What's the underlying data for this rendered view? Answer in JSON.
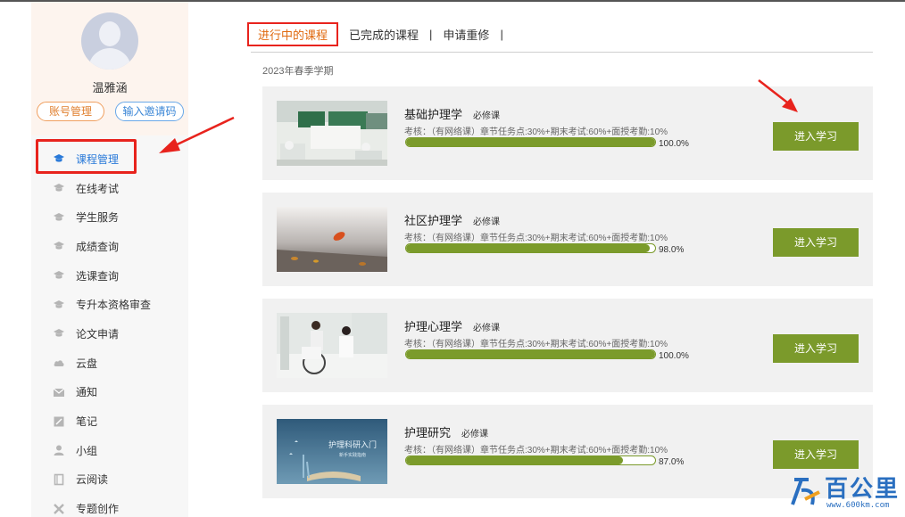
{
  "sidebar": {
    "username": "温雅涵",
    "account_button": "账号管理",
    "invite_button": "输入邀请码",
    "items": [
      {
        "label": "课程管理",
        "icon": "graduation-cap-icon"
      },
      {
        "label": "在线考试",
        "icon": "graduation-cap-icon"
      },
      {
        "label": "学生服务",
        "icon": "graduation-cap-icon"
      },
      {
        "label": "成绩查询",
        "icon": "graduation-cap-icon"
      },
      {
        "label": "选课查询",
        "icon": "graduation-cap-icon"
      },
      {
        "label": "专升本资格审查",
        "icon": "graduation-cap-icon"
      },
      {
        "label": "论文申请",
        "icon": "graduation-cap-icon"
      },
      {
        "label": "云盘",
        "icon": "cloud-icon"
      },
      {
        "label": "通知",
        "icon": "envelope-icon"
      },
      {
        "label": "笔记",
        "icon": "note-icon"
      },
      {
        "label": "小组",
        "icon": "user-icon"
      },
      {
        "label": "云阅读",
        "icon": "book-icon"
      },
      {
        "label": "专题创作",
        "icon": "tools-icon"
      }
    ]
  },
  "tabs": {
    "in_progress": "进行中的课程",
    "completed": "已完成的课程",
    "retake": "申请重修"
  },
  "term": "2023年春季学期",
  "courses": [
    {
      "title": "基础护理学",
      "tag": "必修课",
      "rule": "考核：（有网络课）章节任务点:30%+期末考试:60%+面授考勤:10%",
      "progress": 100.0,
      "progress_text": "100.0%",
      "button": "进入学习"
    },
    {
      "title": "社区护理学",
      "tag": "必修课",
      "rule": "考核：（有网络课）章节任务点:30%+期末考试:60%+面授考勤:10%",
      "progress": 98.0,
      "progress_text": "98.0%",
      "button": "进入学习"
    },
    {
      "title": "护理心理学",
      "tag": "必修课",
      "rule": "考核：（有网络课）章节任务点:30%+期末考试:60%+面授考勤:10%",
      "progress": 100.0,
      "progress_text": "100.0%",
      "button": "进入学习"
    },
    {
      "title": "护理研究",
      "tag": "必修课",
      "rule": "考核：（有网络课）章节任务点:30%+期末考试:60%+面授考勤:10%",
      "progress": 87.0,
      "progress_text": "87.0%",
      "button": "进入学习",
      "thumb_text": "护理科研入门",
      "thumb_subtext": "新手实践指南"
    }
  ],
  "watermark": {
    "text": "百公里",
    "url": "www.600km.com"
  },
  "colors": {
    "accent_blue": "#2a7ad9",
    "green": "#7b9a2b",
    "annotation_red": "#e8231d",
    "tab_orange": "#e06a10"
  }
}
